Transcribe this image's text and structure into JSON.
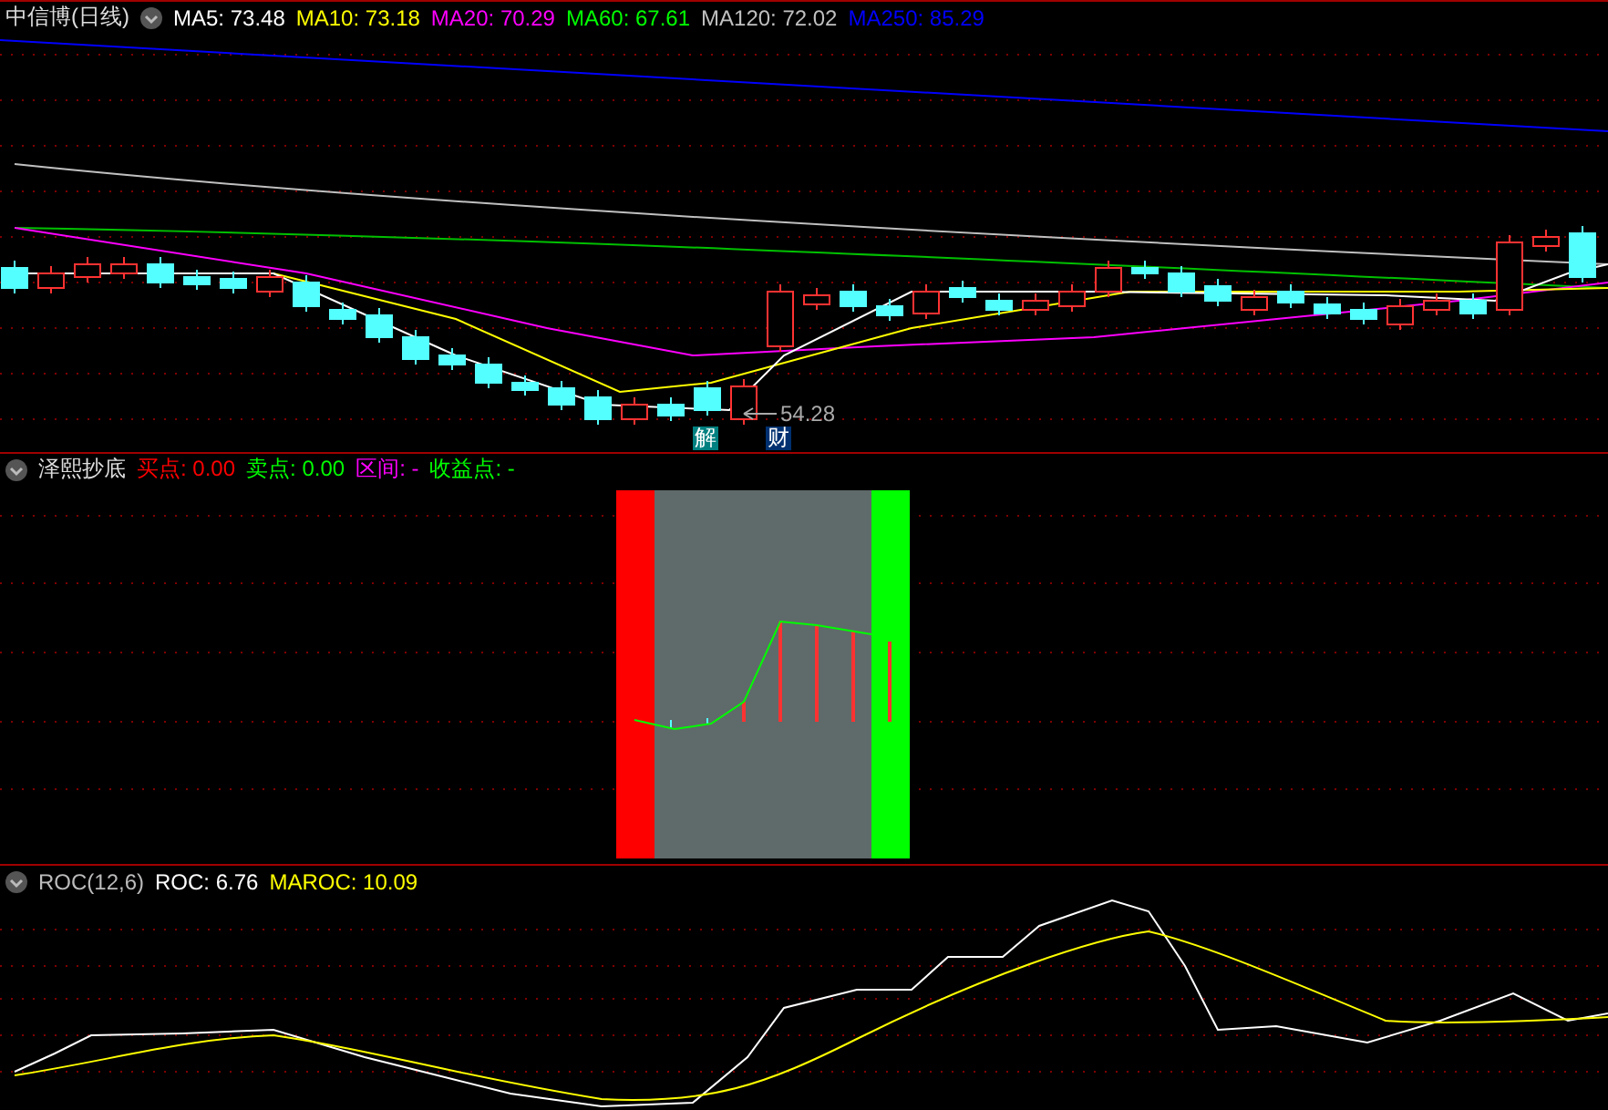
{
  "main_panel": {
    "title": "中信博(日线)",
    "indicators": [
      {
        "label": "MA5: 73.48",
        "color": "#ffffff"
      },
      {
        "label": "MA10: 73.18",
        "color": "#ffff00"
      },
      {
        "label": "MA20: 70.29",
        "color": "#ff00ff"
      },
      {
        "label": "MA60: 67.61",
        "color": "#00ff00"
      },
      {
        "label": "MA120: 72.02",
        "color": "#c0c0c0"
      },
      {
        "label": "MA250: 85.29",
        "color": "#0000ff"
      }
    ],
    "price_label": "54.28",
    "markers": [
      {
        "text": "解",
        "color": "#008080"
      },
      {
        "text": "财",
        "color": "#003070"
      }
    ]
  },
  "signal_panel": {
    "title": "泽熙抄底",
    "fields": [
      {
        "label": "买点: 0.00",
        "color": "#ff0000"
      },
      {
        "label": "卖点: 0.00",
        "color": "#00ff00"
      },
      {
        "label": "区间: -",
        "color": "#ff00ff"
      },
      {
        "label": "收益点: -",
        "color": "#00ff00"
      }
    ]
  },
  "roc_panel": {
    "title": "ROC(12,6)",
    "indicators": [
      {
        "label": "ROC: 6.76",
        "color": "#ffffff"
      },
      {
        "label": "MAROC: 10.09",
        "color": "#ffff00"
      }
    ]
  }
}
